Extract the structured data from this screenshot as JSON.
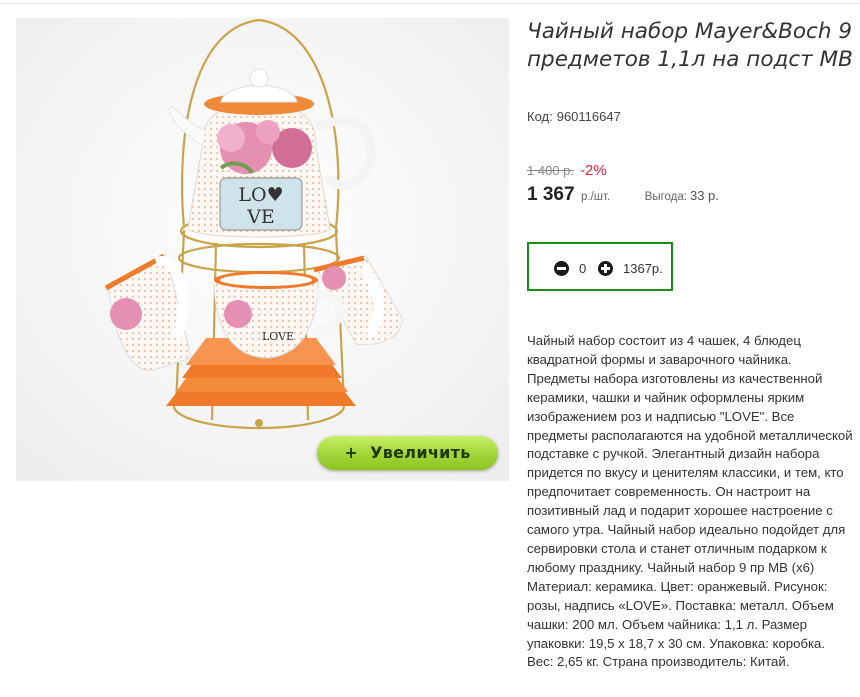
{
  "product": {
    "title": "Чайный набор Mayer&Boch 9 предметов 1,1л на подст МВ",
    "code_label": "Код:",
    "code": "960116647",
    "image_text": "LOVE",
    "zoom_button": {
      "icon": "plus-icon",
      "label": "Увеличить"
    }
  },
  "pricing": {
    "old_price": "1 400 р.",
    "discount": "-2%",
    "price": "1 367",
    "unit": "р./шт.",
    "savings_label": "Выгода:",
    "savings": "33 р."
  },
  "cart": {
    "minus_icon": "minus-circle-icon",
    "plus_icon": "plus-circle-icon",
    "quantity": "0",
    "sum": "1367р.",
    "border_color": "#1a8a1a"
  },
  "description": "Чайный набор состоит из 4 чашек, 4 блюдец квадратной формы и заварочного чайника. Предметы набора изготовлены из качественной керамики, чашки и чайник оформлены ярким изображением роз и надписью \"LOVE\". Все предметы располагаются на удобной металлической подставке с ручкой. Элегантный дизайн набора придется по вкусу и ценителям классики, и тем, кто предпочитает современность. Он настроит на позитивный лад и подарит хорошее настроение с самого утра. Чайный набор идеально подойдет для сервировки стола и станет отличным подарком к любому празднику. Чайный набор 9 пр МВ (х6) Материал: керамика. Цвет: оранжевый. Рисунок: розы, надпись «LOVE». Поставка: металл. Объем чашки: 200 мл. Объем чайника: 1,1 л. Размер упаковки: 19,5 х 18,7 х 30 см. Упаковка: коробка. Вес: 2,65 кг. Страна производитель: Китай.",
  "colors": {
    "discount": "#e1203a",
    "zoom_button": "#a4d73a",
    "saucers": "#f07a2a"
  }
}
